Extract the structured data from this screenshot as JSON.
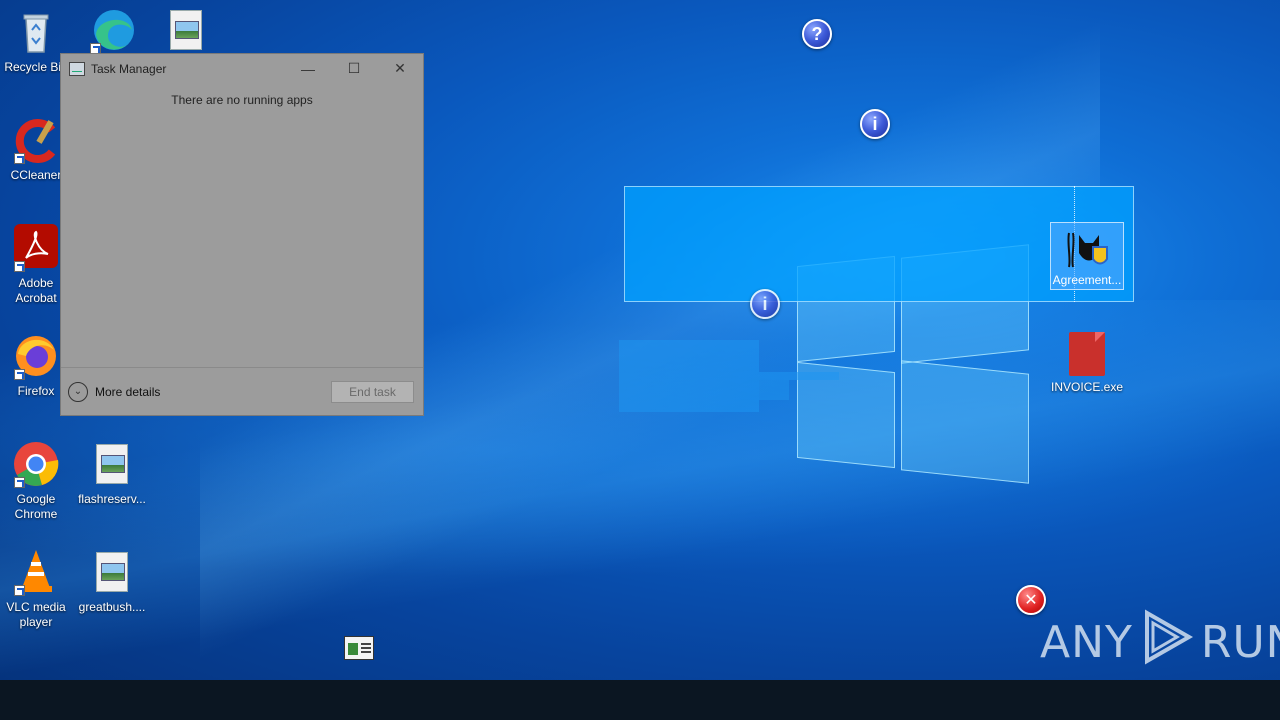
{
  "desktop_icons": [
    {
      "name": "recycle-bin",
      "label": "Recycle Bin"
    },
    {
      "name": "edge",
      "label": ""
    },
    {
      "name": "image-file-top",
      "label": ""
    },
    {
      "name": "ccleaner",
      "label": "CCleaner"
    },
    {
      "name": "adobe-acrobat",
      "label": "Adobe Acrobat"
    },
    {
      "name": "firefox",
      "label": "Firefox"
    },
    {
      "name": "google-chrome",
      "label": "Google Chrome"
    },
    {
      "name": "flashreserv",
      "label": "flashreserv..."
    },
    {
      "name": "vlc",
      "label": "VLC media player"
    },
    {
      "name": "greatbush",
      "label": "greatbush...."
    },
    {
      "name": "agreement",
      "label": "Agreement..."
    },
    {
      "name": "invoice",
      "label": "INVOICE.exe"
    }
  ],
  "task_manager": {
    "title": "Task Manager",
    "minimize": "—",
    "maximize": "☐",
    "close": "✕",
    "empty_message": "There are no running apps",
    "more_details": "More details",
    "end_task": "End task"
  },
  "bubbles": {
    "question": "?",
    "info": "i",
    "error": "✕"
  },
  "watermark": {
    "left": "ANY",
    "right": "RUN"
  }
}
